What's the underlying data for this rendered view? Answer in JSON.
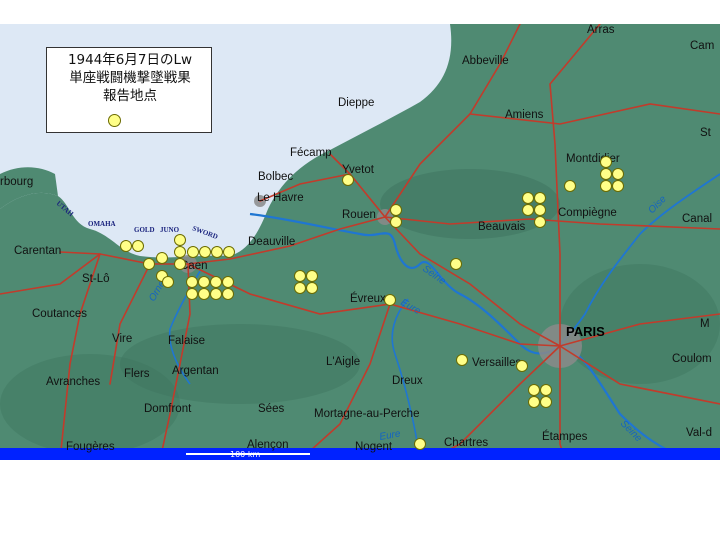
{
  "legend": {
    "line1": "1944年6月7日のLw",
    "line2": "単座戦闘機撃墜戦果",
    "line3": "報告地点"
  },
  "places": {
    "arras": "Arras",
    "cam": "Cam",
    "abbeville": "Abbeville",
    "dieppe": "Dieppe",
    "amiens": "Amiens",
    "st": "St",
    "fecamp": "Fécamp",
    "yvetot": "Yvetot",
    "montdidier": "Montdidier",
    "cherbourg": "rbourg",
    "bolbec": "Bolbec",
    "le_havre": "Le Havre",
    "rouen": "Rouen",
    "beauvais": "Beauvais",
    "compiegne": "Compiègne",
    "canal": "Canal",
    "carentan": "Carentan",
    "deauville": "Deauville",
    "caen": "Caen",
    "st_lo": "St-Lô",
    "evreux": "Évreux",
    "paris": "PARIS",
    "coutances": "Coutances",
    "vire": "Vire",
    "falaise": "Falaise",
    "laigle": "L'Aigle",
    "versailles": "Versailles",
    "meaux": "M",
    "coulom": "Coulom",
    "avranches": "Avranches",
    "flers": "Flers",
    "argentan": "Argentan",
    "dreux": "Dreux",
    "domfront": "Domfront",
    "sees": "Sées",
    "mortagne": "Mortagne-au-Perche",
    "etampes": "Étampes",
    "alencon": "Alençon",
    "nogent": "Nogent",
    "chartres": "Chartres",
    "fougeres": "Fougères",
    "val": "Val-d"
  },
  "beaches": [
    "UTAH",
    "OMAHA",
    "GOLD",
    "JUNO",
    "SWORD"
  ],
  "rivers": {
    "seine": "Seine",
    "oise": "Oise",
    "eure": "Eure",
    "orne": "Orne",
    "eure_south": "Eure",
    "seine_south": "Seine"
  },
  "scale_label": "100 km",
  "colors": {
    "land": "#4f8a72",
    "land_dark": "#3f7560",
    "sea": "#dde8f5",
    "road": "#c23b2b",
    "river": "#1f76d2",
    "urban": "#8a8a8a",
    "marker_fill": "#ffff88",
    "marker_stroke": "#6b6b00",
    "bottom_bar": "#0022ff"
  },
  "report_markers": [
    [
      126,
      246
    ],
    [
      138,
      246
    ],
    [
      149,
      264
    ],
    [
      162,
      258
    ],
    [
      162,
      276
    ],
    [
      168,
      282
    ],
    [
      180,
      240
    ],
    [
      180,
      252
    ],
    [
      193,
      252
    ],
    [
      205,
      252
    ],
    [
      217,
      252
    ],
    [
      229,
      252
    ],
    [
      180,
      264
    ],
    [
      192,
      282
    ],
    [
      204,
      282
    ],
    [
      216,
      282
    ],
    [
      228,
      282
    ],
    [
      192,
      294
    ],
    [
      204,
      294
    ],
    [
      216,
      294
    ],
    [
      228,
      294
    ],
    [
      300,
      276
    ],
    [
      312,
      276
    ],
    [
      300,
      288
    ],
    [
      312,
      288
    ],
    [
      348,
      180
    ],
    [
      396,
      210
    ],
    [
      396,
      222
    ],
    [
      456,
      264
    ],
    [
      390,
      300
    ],
    [
      528,
      198
    ],
    [
      540,
      198
    ],
    [
      528,
      210
    ],
    [
      540,
      210
    ],
    [
      540,
      222
    ],
    [
      570,
      186
    ],
    [
      606,
      162
    ],
    [
      606,
      174
    ],
    [
      618,
      174
    ],
    [
      606,
      186
    ],
    [
      618,
      186
    ],
    [
      462,
      360
    ],
    [
      522,
      366
    ],
    [
      534,
      390
    ],
    [
      546,
      390
    ],
    [
      534,
      402
    ],
    [
      546,
      402
    ],
    [
      420,
      444
    ]
  ]
}
